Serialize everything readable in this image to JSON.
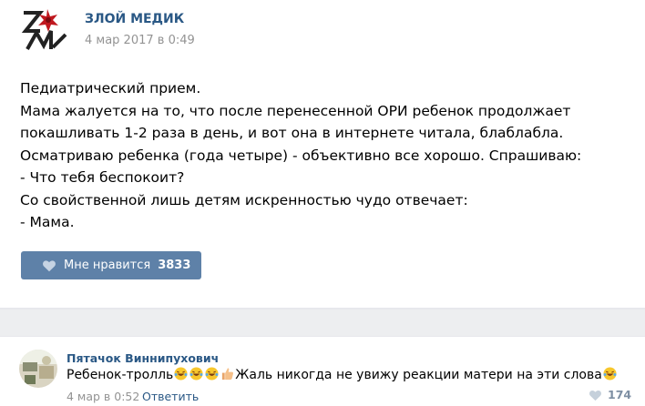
{
  "post": {
    "author": "ЗЛОЙ МЕДИК",
    "date": "4 мар 2017 в 0:49",
    "text_lines": [
      "Педиатрический прием.",
      "Мама жалуется на то, что после перенесенной ОРИ ребенок продолжает",
      "покашливать 1-2 раза в день, и вот она в интернете читала, блаблабла.",
      "Осматриваю ребенка (года четыре) - объективно все хорошо. Спрашиваю:",
      "- Что тебя беспокоит?",
      "Со свойственной лишь детям искренностью чудо отвечает:",
      "- Мама."
    ],
    "like_label": "Мне нравится",
    "like_count": "3833",
    "like_icon": "heart-icon",
    "avatar_icon": "evil-medic-logo"
  },
  "comment": {
    "author": "Пятачок Виннипухович",
    "text_start": "Ребенок-тролль",
    "text_end": "Жаль никогда не увижу реакции матери на эти слова",
    "emojis_inline": [
      "laughing-tears-emoji",
      "laughing-tears-emoji",
      "laughing-tears-emoji",
      "thumbs-up-emoji"
    ],
    "emoji_trailing": "laughing-tears-emoji",
    "date": "4 мар в 0:52",
    "reply_label": "Ответить",
    "like_count": "174",
    "like_icon": "heart-icon"
  },
  "colors": {
    "link": "#2a5885",
    "button": "#5e81a8",
    "muted": "#939393",
    "separator_band": "#edeef0"
  }
}
